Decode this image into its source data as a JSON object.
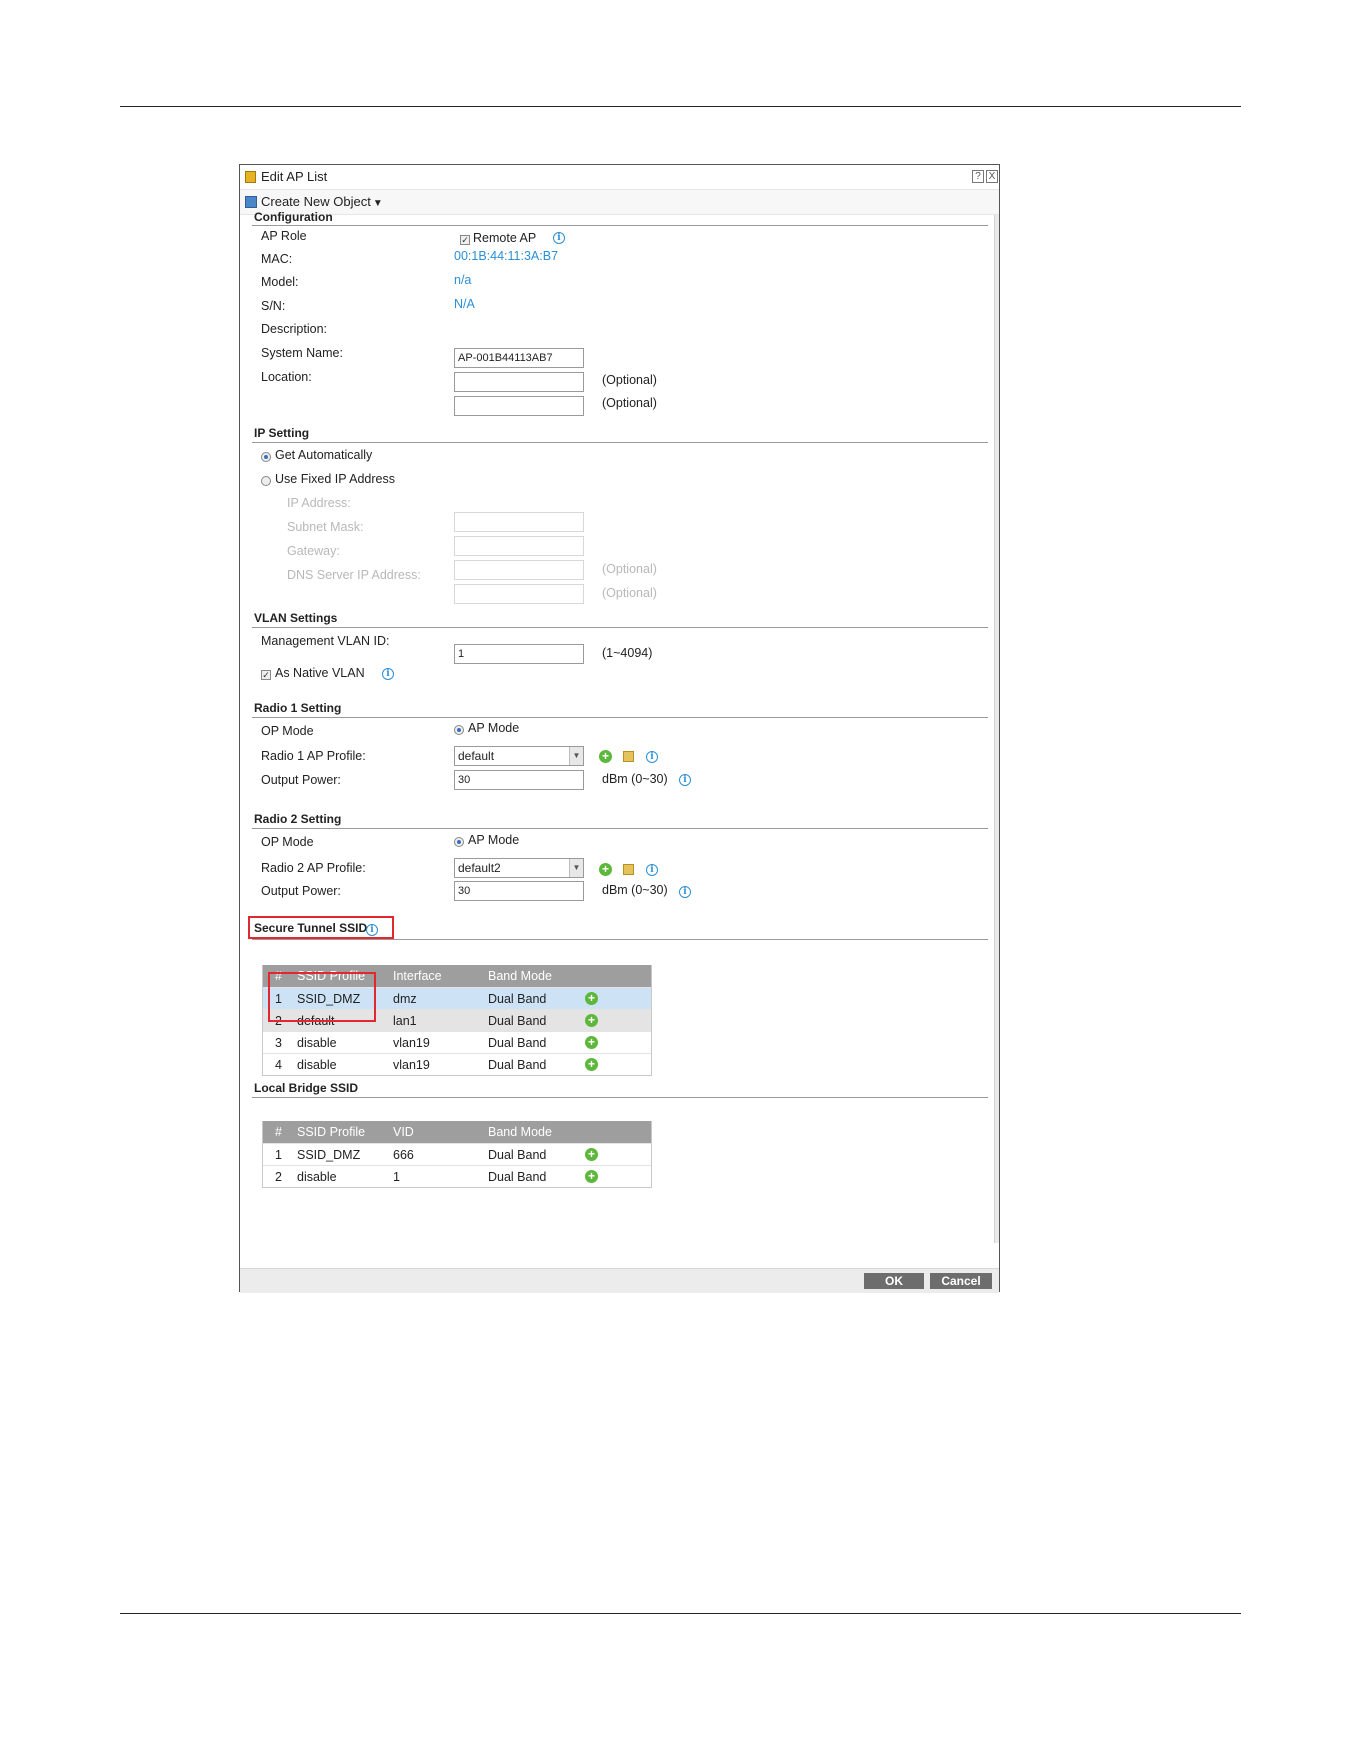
{
  "dialog": {
    "title": "Edit AP List",
    "toolbar": {
      "create_label": "Create New Object",
      "create_arrow": "▼"
    }
  },
  "configuration": {
    "title": "Configuration",
    "ap_role_label": "AP Role",
    "remote_ap_label": "Remote AP",
    "remote_ap_checked": true,
    "mac_label": "MAC:",
    "mac_value": "00:1B:44:11:3A:B7",
    "model_label": "Model:",
    "model_value": "n/a",
    "sn_label": "S/N:",
    "sn_value": "N/A",
    "description_label": "Description:",
    "description_value": "AP-001B44113AB7",
    "system_name_label": "System Name:",
    "system_name_value": "",
    "location_label": "Location:",
    "location_value": "",
    "optional": "(Optional)"
  },
  "ip_setting": {
    "title": "IP Setting",
    "get_auto_label": "Get Automatically",
    "fixed_label": "Use Fixed IP Address",
    "ip_label": "IP Address:",
    "subnet_label": "Subnet Mask:",
    "gateway_label": "Gateway:",
    "dns_label": "DNS Server IP Address:",
    "optional": "(Optional)"
  },
  "vlan": {
    "title": "VLAN Settings",
    "mgmt_label": "Management VLAN ID:",
    "mgmt_value": "1",
    "mgmt_range": "(1~4094)",
    "native_label": "As Native VLAN"
  },
  "radio1": {
    "title": "Radio 1 Setting",
    "op_mode_label": "OP Mode",
    "op_mode_value": "AP Mode",
    "profile_label": "Radio 1 AP Profile:",
    "profile_value": "default",
    "power_label": "Output Power:",
    "power_value": "30",
    "power_unit": "dBm (0~30)"
  },
  "radio2": {
    "title": "Radio 2 Setting",
    "op_mode_label": "OP Mode",
    "op_mode_value": "AP Mode",
    "profile_label": "Radio 2 AP Profile:",
    "profile_value": "default2",
    "power_label": "Output Power:",
    "power_value": "30",
    "power_unit": "dBm (0~30)"
  },
  "secure_tunnel": {
    "title": "Secure Tunnel SSID",
    "headers": [
      "#",
      "SSID Profile",
      "Interface",
      "Band Mode"
    ],
    "rows": [
      [
        "1",
        "SSID_DMZ",
        "dmz",
        "Dual Band"
      ],
      [
        "2",
        "default",
        "lan1",
        "Dual Band"
      ],
      [
        "3",
        "disable",
        "vlan19",
        "Dual Band"
      ],
      [
        "4",
        "disable",
        "vlan19",
        "Dual Band"
      ]
    ]
  },
  "local_bridge": {
    "title": "Local Bridge SSID",
    "headers": [
      "#",
      "SSID Profile",
      "VID",
      "Band Mode"
    ],
    "rows": [
      [
        "1",
        "SSID_DMZ",
        "666",
        "Dual Band"
      ],
      [
        "2",
        "disable",
        "1",
        "Dual Band"
      ]
    ]
  },
  "footer": {
    "ok_label": "OK",
    "cancel_label": "Cancel"
  },
  "icons": {
    "help": "?",
    "close": "X",
    "info": "i",
    "plus": "+",
    "check": "✓"
  },
  "colors": {
    "link_blue": "#2a8fd6",
    "highlight_red": "#e0282e",
    "add_green": "#5db73b",
    "header_gray": "#9e9e9e"
  }
}
